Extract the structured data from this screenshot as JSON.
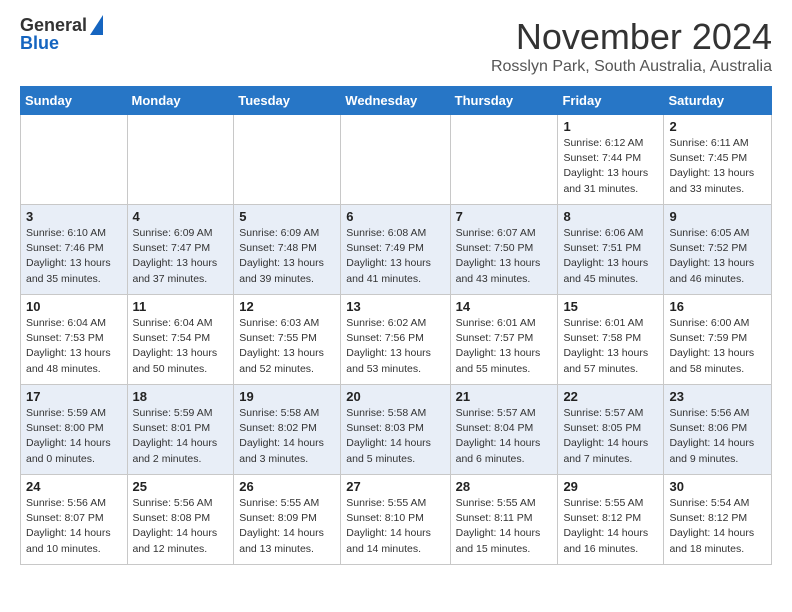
{
  "logo": {
    "line1": "General",
    "line2": "Blue"
  },
  "header": {
    "month": "November 2024",
    "location": "Rosslyn Park, South Australia, Australia"
  },
  "weekdays": [
    "Sunday",
    "Monday",
    "Tuesday",
    "Wednesday",
    "Thursday",
    "Friday",
    "Saturday"
  ],
  "weeks": [
    [
      {
        "day": "",
        "info": ""
      },
      {
        "day": "",
        "info": ""
      },
      {
        "day": "",
        "info": ""
      },
      {
        "day": "",
        "info": ""
      },
      {
        "day": "",
        "info": ""
      },
      {
        "day": "1",
        "info": "Sunrise: 6:12 AM\nSunset: 7:44 PM\nDaylight: 13 hours\nand 31 minutes."
      },
      {
        "day": "2",
        "info": "Sunrise: 6:11 AM\nSunset: 7:45 PM\nDaylight: 13 hours\nand 33 minutes."
      }
    ],
    [
      {
        "day": "3",
        "info": "Sunrise: 6:10 AM\nSunset: 7:46 PM\nDaylight: 13 hours\nand 35 minutes."
      },
      {
        "day": "4",
        "info": "Sunrise: 6:09 AM\nSunset: 7:47 PM\nDaylight: 13 hours\nand 37 minutes."
      },
      {
        "day": "5",
        "info": "Sunrise: 6:09 AM\nSunset: 7:48 PM\nDaylight: 13 hours\nand 39 minutes."
      },
      {
        "day": "6",
        "info": "Sunrise: 6:08 AM\nSunset: 7:49 PM\nDaylight: 13 hours\nand 41 minutes."
      },
      {
        "day": "7",
        "info": "Sunrise: 6:07 AM\nSunset: 7:50 PM\nDaylight: 13 hours\nand 43 minutes."
      },
      {
        "day": "8",
        "info": "Sunrise: 6:06 AM\nSunset: 7:51 PM\nDaylight: 13 hours\nand 45 minutes."
      },
      {
        "day": "9",
        "info": "Sunrise: 6:05 AM\nSunset: 7:52 PM\nDaylight: 13 hours\nand 46 minutes."
      }
    ],
    [
      {
        "day": "10",
        "info": "Sunrise: 6:04 AM\nSunset: 7:53 PM\nDaylight: 13 hours\nand 48 minutes."
      },
      {
        "day": "11",
        "info": "Sunrise: 6:04 AM\nSunset: 7:54 PM\nDaylight: 13 hours\nand 50 minutes."
      },
      {
        "day": "12",
        "info": "Sunrise: 6:03 AM\nSunset: 7:55 PM\nDaylight: 13 hours\nand 52 minutes."
      },
      {
        "day": "13",
        "info": "Sunrise: 6:02 AM\nSunset: 7:56 PM\nDaylight: 13 hours\nand 53 minutes."
      },
      {
        "day": "14",
        "info": "Sunrise: 6:01 AM\nSunset: 7:57 PM\nDaylight: 13 hours\nand 55 minutes."
      },
      {
        "day": "15",
        "info": "Sunrise: 6:01 AM\nSunset: 7:58 PM\nDaylight: 13 hours\nand 57 minutes."
      },
      {
        "day": "16",
        "info": "Sunrise: 6:00 AM\nSunset: 7:59 PM\nDaylight: 13 hours\nand 58 minutes."
      }
    ],
    [
      {
        "day": "17",
        "info": "Sunrise: 5:59 AM\nSunset: 8:00 PM\nDaylight: 14 hours\nand 0 minutes."
      },
      {
        "day": "18",
        "info": "Sunrise: 5:59 AM\nSunset: 8:01 PM\nDaylight: 14 hours\nand 2 minutes."
      },
      {
        "day": "19",
        "info": "Sunrise: 5:58 AM\nSunset: 8:02 PM\nDaylight: 14 hours\nand 3 minutes."
      },
      {
        "day": "20",
        "info": "Sunrise: 5:58 AM\nSunset: 8:03 PM\nDaylight: 14 hours\nand 5 minutes."
      },
      {
        "day": "21",
        "info": "Sunrise: 5:57 AM\nSunset: 8:04 PM\nDaylight: 14 hours\nand 6 minutes."
      },
      {
        "day": "22",
        "info": "Sunrise: 5:57 AM\nSunset: 8:05 PM\nDaylight: 14 hours\nand 7 minutes."
      },
      {
        "day": "23",
        "info": "Sunrise: 5:56 AM\nSunset: 8:06 PM\nDaylight: 14 hours\nand 9 minutes."
      }
    ],
    [
      {
        "day": "24",
        "info": "Sunrise: 5:56 AM\nSunset: 8:07 PM\nDaylight: 14 hours\nand 10 minutes."
      },
      {
        "day": "25",
        "info": "Sunrise: 5:56 AM\nSunset: 8:08 PM\nDaylight: 14 hours\nand 12 minutes."
      },
      {
        "day": "26",
        "info": "Sunrise: 5:55 AM\nSunset: 8:09 PM\nDaylight: 14 hours\nand 13 minutes."
      },
      {
        "day": "27",
        "info": "Sunrise: 5:55 AM\nSunset: 8:10 PM\nDaylight: 14 hours\nand 14 minutes."
      },
      {
        "day": "28",
        "info": "Sunrise: 5:55 AM\nSunset: 8:11 PM\nDaylight: 14 hours\nand 15 minutes."
      },
      {
        "day": "29",
        "info": "Sunrise: 5:55 AM\nSunset: 8:12 PM\nDaylight: 14 hours\nand 16 minutes."
      },
      {
        "day": "30",
        "info": "Sunrise: 5:54 AM\nSunset: 8:12 PM\nDaylight: 14 hours\nand 18 minutes."
      }
    ]
  ]
}
